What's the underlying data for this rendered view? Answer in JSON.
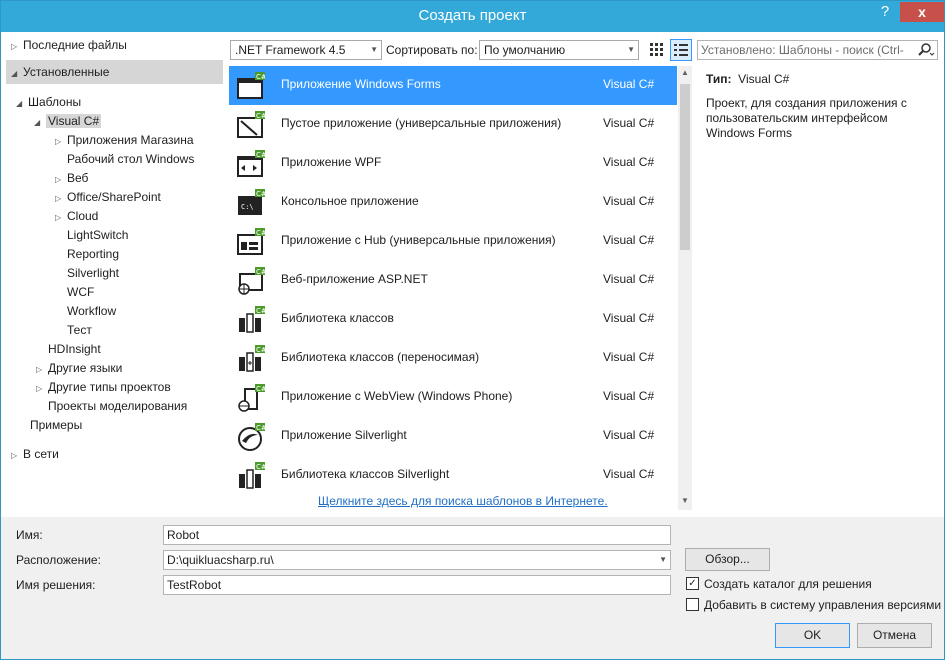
{
  "window": {
    "title": "Создать проект",
    "help": "?",
    "close": "x"
  },
  "tree": {
    "recent": "Последние файлы",
    "installed": "Установленные",
    "templates": "Шаблоны",
    "visual_cs": "Visual C#",
    "children": [
      "Приложения Магазина",
      "Рабочий стол Windows",
      "Веб",
      "Office/SharePoint",
      "Cloud",
      "LightSwitch",
      "Reporting",
      "Silverlight",
      "WCF",
      "Workflow",
      "Тест"
    ],
    "hdinsight": "HDInsight",
    "other_langs": "Другие языки",
    "other_types": "Другие типы проектов",
    "modeling": "Проекты моделирования",
    "samples": "Примеры",
    "online": "В сети"
  },
  "toolbar": {
    "framework": ".NET Framework 4.5",
    "sort_label": "Сортировать по:",
    "sort_value": "По умолчанию",
    "search_placeholder": "Установлено: Шаблоны - поиск (Ctrl-"
  },
  "templates": [
    {
      "name": "Приложение Windows Forms",
      "lang": "Visual C#"
    },
    {
      "name": "Пустое приложение (универсальные приложения)",
      "lang": "Visual C#"
    },
    {
      "name": "Приложение WPF",
      "lang": "Visual C#"
    },
    {
      "name": "Консольное приложение",
      "lang": "Visual C#"
    },
    {
      "name": "Приложение с Hub (универсальные приложения)",
      "lang": "Visual C#"
    },
    {
      "name": "Веб-приложение ASP.NET",
      "lang": "Visual C#"
    },
    {
      "name": "Библиотека классов",
      "lang": "Visual C#"
    },
    {
      "name": "Библиотека классов (переносимая)",
      "lang": "Visual C#"
    },
    {
      "name": "Приложение с WebView (Windows Phone)",
      "lang": "Visual C#"
    },
    {
      "name": "Приложение Silverlight",
      "lang": "Visual C#"
    },
    {
      "name": "Библиотека классов Silverlight",
      "lang": "Visual C#"
    }
  ],
  "info": {
    "type_label": "Тип:",
    "type_value": "Visual C#",
    "description": "Проект, для создания приложения с пользовательским интерфейсом Windows Forms"
  },
  "online_link": "Щелкните здесь для поиска шаблонов в Интернете.",
  "form": {
    "name_label": "Имя:",
    "name_value": "Robot",
    "location_label": "Расположение:",
    "location_value": "D:\\quikluacsharp.ru\\",
    "solution_label": "Имя решения:",
    "solution_value": "TestRobot",
    "browse": "Обзор...",
    "create_dir": "Создать каталог для решения",
    "add_vcs": "Добавить в систему управления версиями",
    "ok": "OK",
    "cancel": "Отмена"
  },
  "colors": {
    "titlebar": "#33a9d9",
    "selection": "#3399ff",
    "close": "#c7504b",
    "link": "#1f6fc5"
  }
}
